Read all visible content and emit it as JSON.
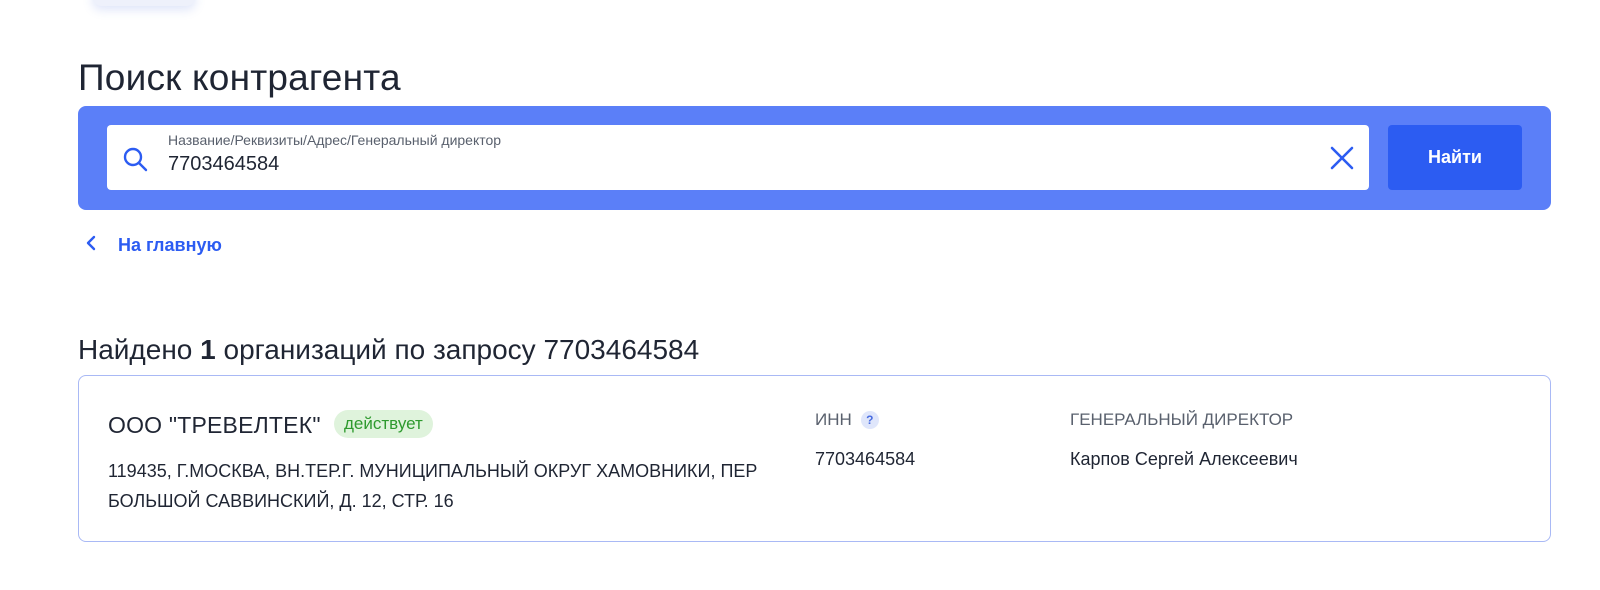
{
  "page": {
    "title": "Поиск контрагента"
  },
  "search": {
    "label": "Название/Реквизиты/Адрес/Генеральный директор",
    "value": "7703464584",
    "button_label": "Найти",
    "icon": "search-icon",
    "clear_icon": "close-icon"
  },
  "nav": {
    "back_label": "На главную",
    "back_icon": "chevron-left-icon"
  },
  "results": {
    "prefix": "Найдено ",
    "count": "1",
    "suffix": " организаций по запросу 7703464584"
  },
  "result_card": {
    "company_name": "ООО \"ТРЕВЕЛТЕК\"",
    "status": "действует",
    "address": "119435, Г.МОСКВА, ВН.ТЕР.Г. МУНИЦИПАЛЬНЫЙ ОКРУГ ХАМОВНИКИ, ПЕР БОЛЬШОЙ САВВИНСКИЙ, Д. 12, СТР. 16",
    "inn_label": "ИНН",
    "inn_help": "?",
    "inn_value": "7703464584",
    "director_label": "ГЕНЕРАЛЬНЫЙ ДИРЕКТОР",
    "director_value": "Карпов Сергей Алексеевич"
  },
  "colors": {
    "panel": "#5b7ff8",
    "accent": "#2c5cf2",
    "status_bg": "#dff3dc",
    "status_text": "#2e9a2e"
  }
}
